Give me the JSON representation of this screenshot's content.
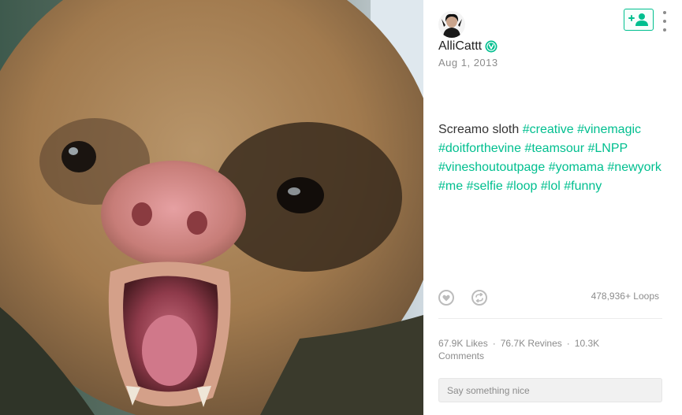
{
  "post": {
    "username": "AlliCattt",
    "date": "Aug 1, 2013",
    "caption_text": "Screamo sloth",
    "hashtags": [
      "#creative",
      "#vinemagic",
      "#doitforthevine",
      "#teamsour",
      "#LNPP",
      "#vineshoutoutpage",
      "#yomama",
      "#newyork",
      "#me",
      "#selfie",
      "#loop",
      "#lol",
      "#funny"
    ],
    "loops": "478,936+ Loops",
    "likes": "67.9K Likes",
    "revines": "76.7K Revines",
    "comments": "10.3K Comments"
  },
  "comment_input": {
    "placeholder": "Say something nice"
  },
  "icons": {
    "follow": "add-person-icon",
    "more": "more-vertical-icon",
    "like": "heart-icon",
    "revine": "revine-icon",
    "verified": "verified-badge-icon"
  },
  "colors": {
    "accent": "#00bf8f",
    "muted": "#8c8c8c",
    "text": "#333333"
  }
}
